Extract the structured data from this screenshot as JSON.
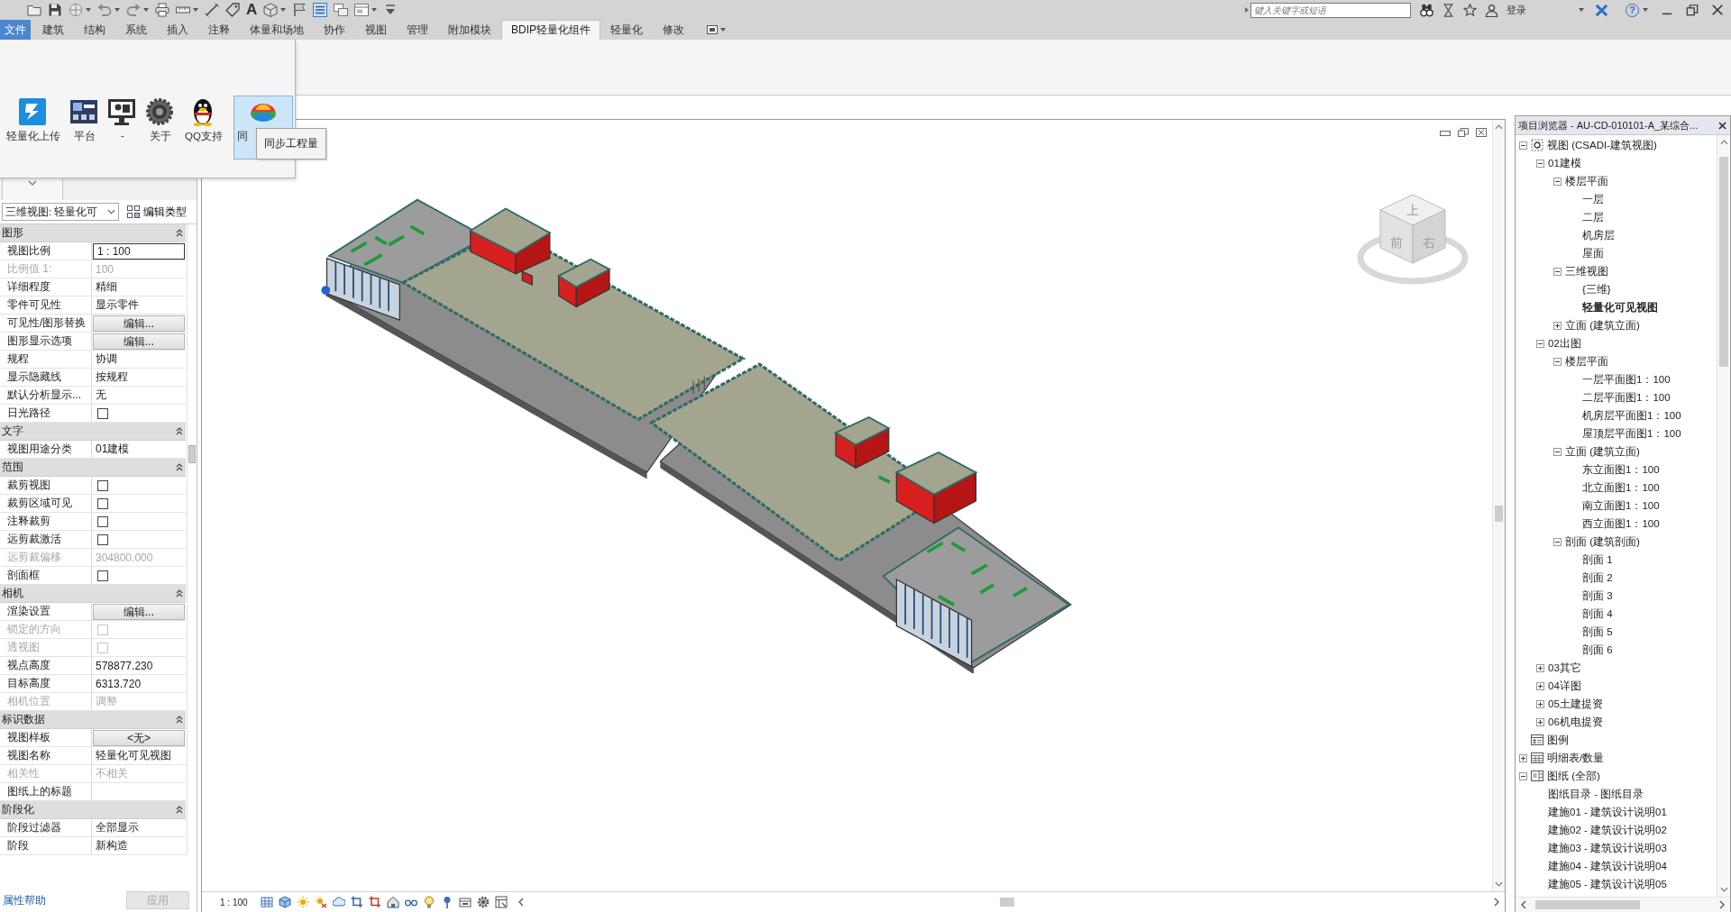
{
  "quick_access": {
    "text_tool": "A"
  },
  "title_bar": {
    "search": {
      "placeholder": "键入关键字或短语"
    },
    "sign_in": "登录",
    "help": "?"
  },
  "ribbon": {
    "tabs": [
      {
        "label": "文件",
        "kind": "application",
        "selected": false
      },
      {
        "label": "建筑",
        "kind": "tab",
        "selected": false
      },
      {
        "label": "结构",
        "kind": "tab",
        "selected": false
      },
      {
        "label": "系统",
        "kind": "tab",
        "selected": false
      },
      {
        "label": "插入",
        "kind": "tab",
        "selected": false
      },
      {
        "label": "注释",
        "kind": "tab",
        "selected": false
      },
      {
        "label": "体量和场地",
        "kind": "tab",
        "selected": false
      },
      {
        "label": "协作",
        "kind": "tab",
        "selected": false
      },
      {
        "label": "视图",
        "kind": "tab",
        "selected": false
      },
      {
        "label": "管理",
        "kind": "tab",
        "selected": false
      },
      {
        "label": "附加模块",
        "kind": "tab",
        "selected": false
      },
      {
        "label": "BDIP轻量化组件",
        "kind": "tab",
        "selected": true
      },
      {
        "label": "轻量化",
        "kind": "tab",
        "selected": false
      },
      {
        "label": "修改",
        "kind": "tab",
        "selected": false
      }
    ],
    "panel": {
      "buttons": [
        {
          "label": "轻量化上传",
          "hovered": false
        },
        {
          "label": "平台",
          "hovered": false
        },
        {
          "label": "-",
          "hovered": false
        },
        {
          "label": "关于",
          "hovered": false
        },
        {
          "label": "QQ支持",
          "hovered": false
        },
        {
          "label": "同",
          "hovered": true
        }
      ],
      "tooltip": "同步工程量"
    }
  },
  "properties": {
    "type_selector": "三维视图: 轻量化可",
    "edit_type": "编辑类型",
    "sections": [
      {
        "title": "图形",
        "expanded": true,
        "rows": [
          {
            "label": "视图比例",
            "kind": "field",
            "value": "1 : 100",
            "disabled": false
          },
          {
            "label": "比例值 1:",
            "kind": "text",
            "value": "100",
            "disabled": true
          },
          {
            "label": "详细程度",
            "kind": "text",
            "value": "精细",
            "disabled": false
          },
          {
            "label": "零件可见性",
            "kind": "text",
            "value": "显示零件",
            "disabled": false
          },
          {
            "label": "可见性/图形替换",
            "kind": "button",
            "value": "编辑...",
            "disabled": false
          },
          {
            "label": "图形显示选项",
            "kind": "button",
            "value": "编辑...",
            "disabled": false
          },
          {
            "label": "规程",
            "kind": "text",
            "value": "协调",
            "disabled": false
          },
          {
            "label": "显示隐藏线",
            "kind": "text",
            "value": "按规程",
            "disabled": false
          },
          {
            "label": "默认分析显示...",
            "kind": "text",
            "value": "无",
            "disabled": false
          },
          {
            "label": "日光路径",
            "kind": "checkbox",
            "checked": false,
            "disabled": false
          }
        ]
      },
      {
        "title": "文字",
        "expanded": true,
        "rows": [
          {
            "label": "视图用途分类",
            "kind": "text",
            "value": "01建模",
            "disabled": false
          }
        ]
      },
      {
        "title": "范围",
        "expanded": true,
        "rows": [
          {
            "label": "裁剪视图",
            "kind": "checkbox",
            "checked": false,
            "disabled": false
          },
          {
            "label": "裁剪区域可见",
            "kind": "checkbox",
            "checked": false,
            "disabled": false
          },
          {
            "label": "注释裁剪",
            "kind": "checkbox",
            "checked": false,
            "disabled": false
          },
          {
            "label": "远剪裁激活",
            "kind": "checkbox",
            "checked": false,
            "disabled": false
          },
          {
            "label": "远剪裁偏移",
            "kind": "text",
            "value": "304800.000",
            "disabled": true
          },
          {
            "label": "剖面框",
            "kind": "checkbox",
            "checked": false,
            "disabled": false
          }
        ]
      },
      {
        "title": "相机",
        "expanded": true,
        "rows": [
          {
            "label": "渲染设置",
            "kind": "button",
            "value": "编辑...",
            "disabled": false
          },
          {
            "label": "锁定的方向",
            "kind": "checkbox",
            "checked": false,
            "disabled": true
          },
          {
            "label": "透视图",
            "kind": "checkbox",
            "checked": false,
            "disabled": true
          },
          {
            "label": "视点高度",
            "kind": "text",
            "value": "578877.230",
            "disabled": false
          },
          {
            "label": "目标高度",
            "kind": "text",
            "value": "6313.720",
            "disabled": false
          },
          {
            "label": "相机位置",
            "kind": "text",
            "value": "调整",
            "disabled": true
          }
        ]
      },
      {
        "title": "标识数据",
        "expanded": true,
        "rows": [
          {
            "label": "视图样板",
            "kind": "button",
            "value": "<无>",
            "disabled": false
          },
          {
            "label": "视图名称",
            "kind": "text",
            "value": "轻量化可见视图",
            "disabled": false
          },
          {
            "label": "相关性",
            "kind": "text",
            "value": "不相关",
            "disabled": true
          },
          {
            "label": "图纸上的标题",
            "kind": "text",
            "disabled": false
          }
        ]
      },
      {
        "title": "阶段化",
        "expanded": true,
        "rows": [
          {
            "label": "阶段过滤器",
            "kind": "text",
            "value": "全部显示",
            "disabled": false
          },
          {
            "label": "阶段",
            "kind": "text",
            "value": "新构造",
            "disabled": false
          }
        ]
      }
    ],
    "help_link": "属性帮助",
    "apply": {
      "label": "应用",
      "disabled": true
    }
  },
  "viewport": {
    "scale": "1 : 100",
    "view_cube": {
      "top": "上",
      "front": "前",
      "right": "右"
    }
  },
  "browser": {
    "title": "项目浏览器 - AU-CD-010101-A_某综合...",
    "tree": [
      {
        "label": "视图 (CSADI-建筑视图)",
        "kind": "views",
        "expanded": true,
        "active": false,
        "children": [
          {
            "label": "01建模",
            "expanded": true,
            "active": false,
            "children": [
              {
                "label": "楼层平面",
                "expanded": true,
                "active": false,
                "children": [
                  {
                    "label": "一层",
                    "active": false
                  },
                  {
                    "label": "二层",
                    "active": false
                  },
                  {
                    "label": "机房层",
                    "active": false
                  },
                  {
                    "label": "屋面",
                    "active": false
                  }
                ]
              },
              {
                "label": "三维视图",
                "expanded": true,
                "active": false,
                "children": [
                  {
                    "label": "{三维}",
                    "active": false
                  },
                  {
                    "label": "轻量化可见视图",
                    "active": true
                  }
                ]
              },
              {
                "label": "立面 (建筑立面)",
                "expanded": false,
                "active": false
              }
            ]
          },
          {
            "label": "02出图",
            "expanded": true,
            "active": false,
            "children": [
              {
                "label": "楼层平面",
                "expanded": true,
                "active": false,
                "children": [
                  {
                    "label": "一层平面图1：100",
                    "active": false
                  },
                  {
                    "label": "二层平面图1：100",
                    "active": false
                  },
                  {
                    "label": "机房层平面图1：100",
                    "active": false
                  },
                  {
                    "label": "屋顶层平面图1：100",
                    "active": false
                  }
                ]
              },
              {
                "label": "立面 (建筑立面)",
                "expanded": true,
                "active": false,
                "children": [
                  {
                    "label": "东立面图1：100",
                    "active": false
                  },
                  {
                    "label": "北立面图1：100",
                    "active": false
                  },
                  {
                    "label": "南立面图1：100",
                    "active": false
                  },
                  {
                    "label": "西立面图1：100",
                    "active": false
                  }
                ]
              },
              {
                "label": "剖面 (建筑剖面)",
                "expanded": true,
                "active": false,
                "children": [
                  {
                    "label": "剖面 1",
                    "active": false
                  },
                  {
                    "label": "剖面 2",
                    "active": false
                  },
                  {
                    "label": "剖面 3",
                    "active": false
                  },
                  {
                    "label": "剖面 4",
                    "active": false
                  },
                  {
                    "label": "剖面 5",
                    "active": false
                  },
                  {
                    "label": "剖面 6",
                    "active": false
                  }
                ]
              }
            ]
          },
          {
            "label": "03其它",
            "expanded": false,
            "active": false
          },
          {
            "label": "04详图",
            "expanded": false,
            "active": false
          },
          {
            "label": "05土建提资",
            "expanded": false,
            "active": false
          },
          {
            "label": "06机电提资",
            "expanded": false,
            "active": false
          }
        ]
      },
      {
        "label": "图例",
        "kind": "legend",
        "active": false
      },
      {
        "label": "明细表/数量",
        "kind": "schedules",
        "expanded": false,
        "active": false
      },
      {
        "label": "图纸 (全部)",
        "kind": "sheets",
        "expanded": true,
        "active": false,
        "children": [
          {
            "label": "图纸目录 - 图纸目录",
            "active": false
          },
          {
            "label": "建施01 - 建筑设计说明01",
            "active": false
          },
          {
            "label": "建施02 - 建筑设计说明02",
            "active": false
          },
          {
            "label": "建施03 - 建筑设计说明03",
            "active": false
          },
          {
            "label": "建施04 - 建筑设计说明04",
            "active": false
          },
          {
            "label": "建施05 - 建筑设计说明05",
            "active": false
          }
        ]
      }
    ]
  }
}
